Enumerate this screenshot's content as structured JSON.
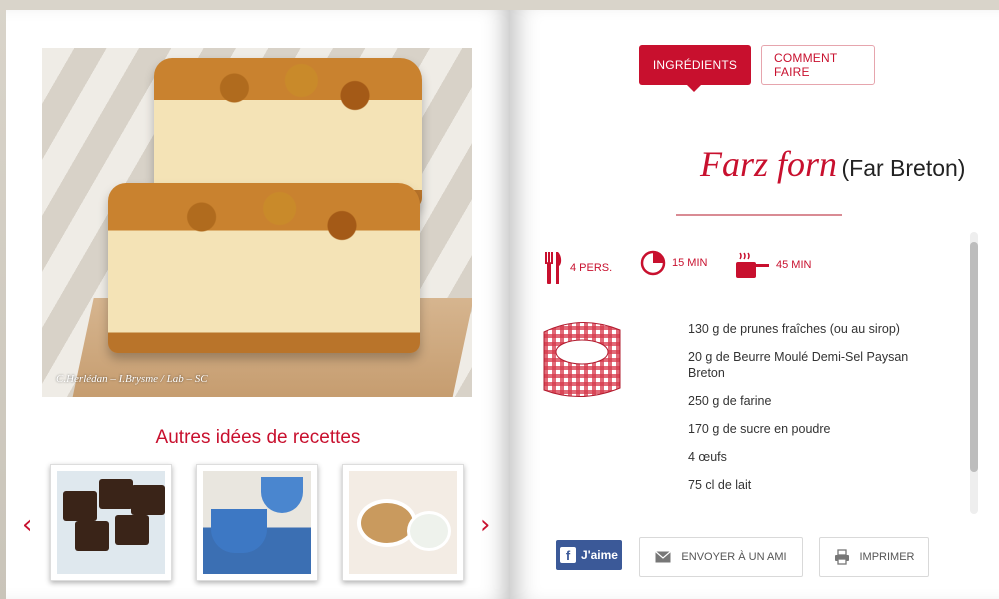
{
  "left_page": {
    "photo_credit": "C.Herlédan – I.Brysme / Lab – SC",
    "other_recipes_title": "Autres idées de recettes",
    "nav": {
      "prev_label": "‹",
      "next_label": "›"
    }
  },
  "right_page": {
    "tabs": [
      {
        "label": "INGRÉDIENTS",
        "active": true
      },
      {
        "label": "COMMENT FAIRE",
        "active": false
      }
    ],
    "title": {
      "breton": "Farz forn",
      "french": "(Far Breton)"
    },
    "meta": {
      "persons": "4 PERS.",
      "prep_time": "15 MIN",
      "cook_time": "45 MIN"
    },
    "ingredients": [
      "130 g de prunes fraîches (ou au sirop)",
      "20 g de Beurre Moulé Demi-Sel Paysan Breton",
      "250 g de farine",
      "170 g de sucre en poudre",
      "4 œufs",
      "75 cl de lait"
    ],
    "actions": {
      "like_label": "J'aime",
      "send_label": "ENVOYER À UN AMI",
      "print_label": "IMPRIMER"
    }
  },
  "colors": {
    "accent": "#c8102e",
    "facebook": "#3b5998"
  }
}
